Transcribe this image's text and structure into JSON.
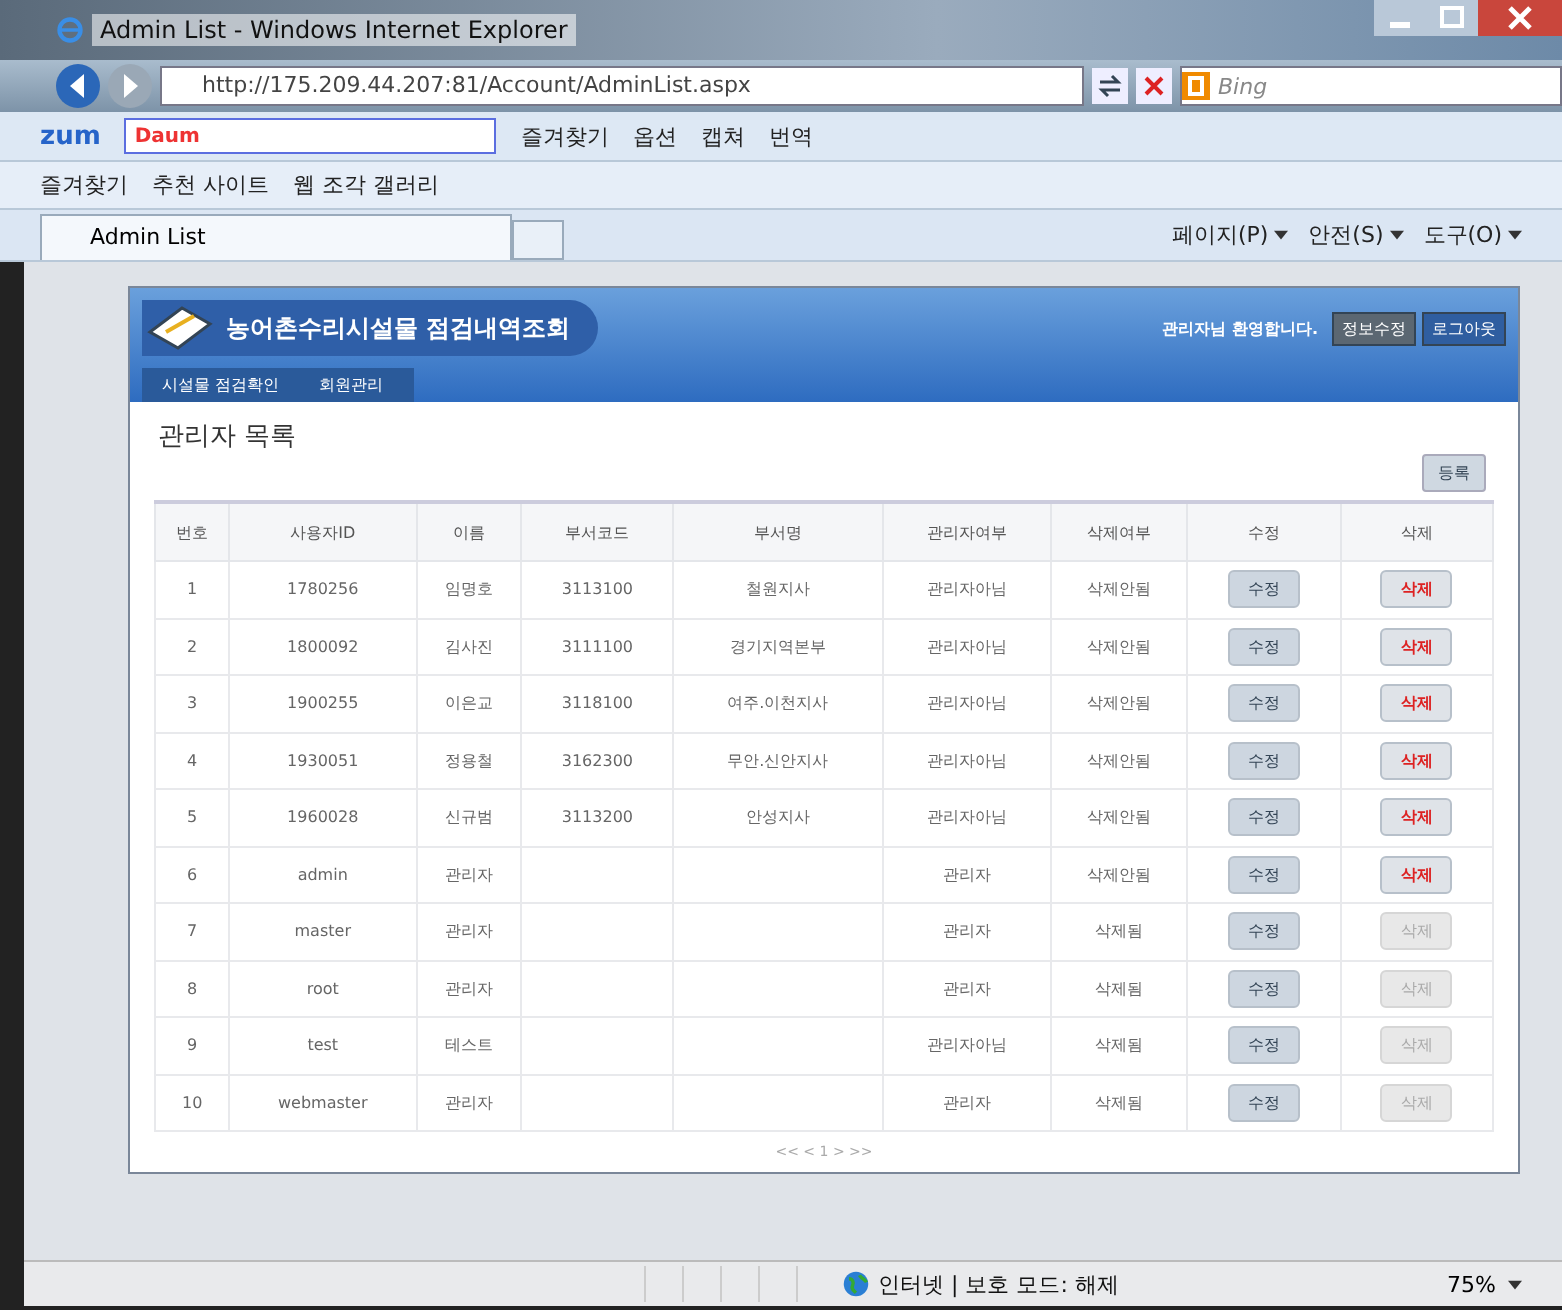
{
  "window": {
    "title": "Admin List - Windows Internet Explorer"
  },
  "address_bar": {
    "url": "http://175.209.44.207:81/Account/AdminList.aspx",
    "search_placeholder": "Bing"
  },
  "toolbar": {
    "brand": "zum",
    "search_logo": "Daum",
    "items": [
      "즐겨찾기",
      "옵션",
      "캡쳐",
      "번역"
    ]
  },
  "favorites_bar": {
    "items": [
      "즐겨찾기",
      "추천 사이트",
      "웹 조각 갤러리"
    ]
  },
  "tab": {
    "label": "Admin List"
  },
  "command_bar": {
    "items": [
      "페이지(P)",
      "안전(S)",
      "도구(O)"
    ]
  },
  "page": {
    "site_title": "농어촌수리시설물 점검내역조회",
    "nav": [
      {
        "label": "시설물 점검확인",
        "selected": false
      },
      {
        "label": "회원관리",
        "selected": false
      }
    ],
    "welcome": "관리자님 환영합니다.",
    "header_buttons": [
      "정보수정",
      "로그아웃"
    ],
    "heading": "관리자 목록",
    "register_button": "등록",
    "table": {
      "columns": [
        "번호",
        "사용자ID",
        "이름",
        "부서코드",
        "부서명",
        "관리자여부",
        "삭제여부",
        "수정",
        "삭제"
      ],
      "rows": [
        {
          "no": "1",
          "user_id": "1780256",
          "name": "임명호",
          "dept_code": "3113100",
          "dept_name": "철원지사",
          "admin": "관리자아님",
          "deleted": "삭제안됨",
          "edit": "수정",
          "delete": "삭제",
          "delete_enabled": true
        },
        {
          "no": "2",
          "user_id": "1800092",
          "name": "김사진",
          "dept_code": "3111100",
          "dept_name": "경기지역본부",
          "admin": "관리자아님",
          "deleted": "삭제안됨",
          "edit": "수정",
          "delete": "삭제",
          "delete_enabled": true
        },
        {
          "no": "3",
          "user_id": "1900255",
          "name": "이은교",
          "dept_code": "3118100",
          "dept_name": "여주.이천지사",
          "admin": "관리자아님",
          "deleted": "삭제안됨",
          "edit": "수정",
          "delete": "삭제",
          "delete_enabled": true
        },
        {
          "no": "4",
          "user_id": "1930051",
          "name": "정용철",
          "dept_code": "3162300",
          "dept_name": "무안.신안지사",
          "admin": "관리자아님",
          "deleted": "삭제안됨",
          "edit": "수정",
          "delete": "삭제",
          "delete_enabled": true
        },
        {
          "no": "5",
          "user_id": "1960028",
          "name": "신규범",
          "dept_code": "3113200",
          "dept_name": "안성지사",
          "admin": "관리자아님",
          "deleted": "삭제안됨",
          "edit": "수정",
          "delete": "삭제",
          "delete_enabled": true
        },
        {
          "no": "6",
          "user_id": "admin",
          "name": "관리자",
          "admin": "관리자",
          "deleted": "삭제안됨",
          "edit": "수정",
          "delete": "삭제",
          "delete_enabled": true
        },
        {
          "no": "7",
          "user_id": "master",
          "name": "관리자",
          "admin": "관리자",
          "deleted": "삭제됨",
          "edit": "수정",
          "delete": "삭제",
          "delete_enabled": false
        },
        {
          "no": "8",
          "user_id": "root",
          "name": "관리자",
          "admin": "관리자",
          "deleted": "삭제됨",
          "edit": "수정",
          "delete": "삭제",
          "delete_enabled": false
        },
        {
          "no": "9",
          "user_id": "test",
          "name": "테스트",
          "admin": "관리자아님",
          "deleted": "삭제됨",
          "edit": "수정",
          "delete": "삭제",
          "delete_enabled": false
        },
        {
          "no": "10",
          "user_id": "webmaster",
          "name": "관리자",
          "admin": "관리자",
          "deleted": "삭제됨",
          "edit": "수정",
          "delete": "삭제",
          "delete_enabled": false
        }
      ]
    },
    "pagination": "<< < 1 > >>"
  },
  "status_bar": {
    "zone": "인터넷 | 보호 모드: 해제",
    "zoom": "75%"
  }
}
